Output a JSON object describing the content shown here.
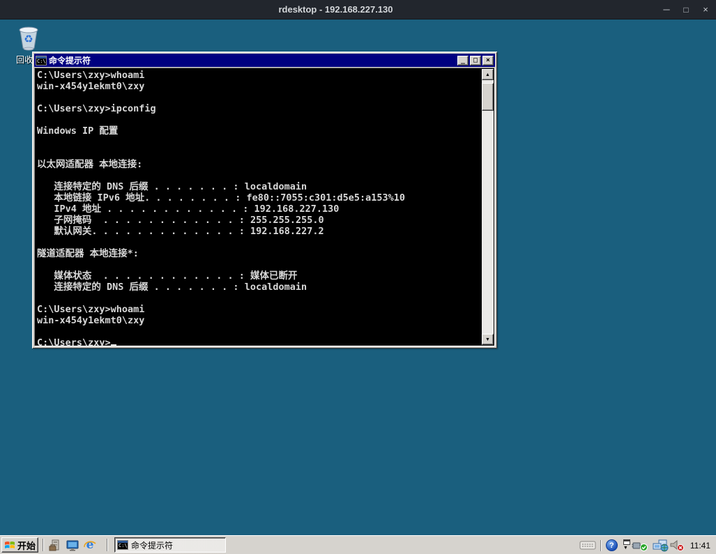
{
  "colors": {
    "topbar_bg": "#22262d",
    "topbar_text": "#d4d7da",
    "desktop_bg": "#1a5f7e",
    "chrome": "#d6d3ce",
    "cmd_title_bg": "#000080",
    "terminal_bg": "#000000",
    "terminal_fg": "#d8d8d8"
  },
  "topbar": {
    "title": "rdesktop - 192.168.227.130"
  },
  "desktop": {
    "recycle_bin": {
      "label": "回收站"
    }
  },
  "cmd_window": {
    "title": "命令提示符",
    "terminal": {
      "lines": [
        "C:\\Users\\zxy>whoami",
        "win-x454y1ekmt0\\zxy",
        "",
        "C:\\Users\\zxy>ipconfig",
        "",
        "Windows IP 配置",
        "",
        "",
        "以太网适配器 本地连接:",
        "",
        "   连接特定的 DNS 后缀 . . . . . . . : localdomain",
        "   本地链接 IPv6 地址. . . . . . . . : fe80::7055:c301:d5e5:a153%10",
        "   IPv4 地址 . . . . . . . . . . . . : 192.168.227.130",
        "   子网掩码  . . . . . . . . . . . . : 255.255.255.0",
        "   默认网关. . . . . . . . . . . . . : 192.168.227.2",
        "",
        "隧道适配器 本地连接*:",
        "",
        "   媒体状态  . . . . . . . . . . . . : 媒体已断开",
        "   连接特定的 DNS 后缀 . . . . . . . : localdomain",
        "",
        "C:\\Users\\zxy>whoami",
        "win-x454y1ekmt0\\zxy",
        "",
        "C:\\Users\\zxy>"
      ]
    }
  },
  "taskbar": {
    "start": {
      "label": "开始"
    },
    "quick_launch": [
      {
        "name": "server-manager"
      },
      {
        "name": "show-desktop"
      },
      {
        "name": "internet-explorer"
      }
    ],
    "tasks": [
      {
        "label": "命令提示符",
        "active": true
      }
    ],
    "tray": {
      "clock": "11:41"
    }
  },
  "icons": {
    "topbar_min": "─",
    "topbar_max": "□",
    "topbar_close": "×",
    "win_min": "_",
    "win_max": "□",
    "win_close": "×",
    "scroll_up": "▲",
    "scroll_down": "▼",
    "chevron_down": "▼",
    "help_glyph": "?",
    "ie_glyph": "e",
    "recycle_glyph": "♻"
  }
}
